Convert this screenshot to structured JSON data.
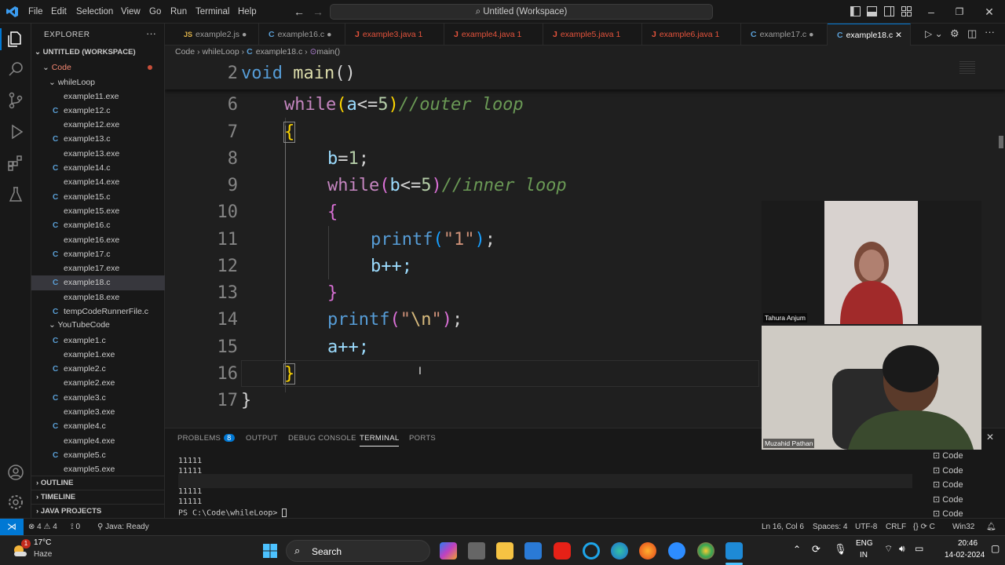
{
  "menu": [
    "File",
    "Edit",
    "Selection",
    "View",
    "Go",
    "Run",
    "Terminal",
    "Help"
  ],
  "command_center": "Untitled (Workspace)",
  "sidebar": {
    "title": "EXPLORER",
    "workspace": "UNTITLED (WORKSPACE)",
    "root": "Code",
    "folder1": "whileLoop",
    "files1": [
      "example11.exe",
      "example12.c",
      "example12.exe",
      "example13.c",
      "example13.exe",
      "example14.c",
      "example14.exe",
      "example15.c",
      "example15.exe",
      "example16.c",
      "example16.exe",
      "example17.c",
      "example17.exe",
      "example18.c",
      "example18.exe",
      "tempCodeRunnerFile.c"
    ],
    "folder2": "YouTubeCode",
    "files2": [
      "example1.c",
      "example1.exe",
      "example2.c",
      "example2.exe",
      "example3.c",
      "example3.exe",
      "example4.c",
      "example4.exe",
      "example5.c",
      "example5.exe"
    ],
    "sections": [
      "OUTLINE",
      "TIMELINE",
      "JAVA PROJECTS"
    ]
  },
  "tabs": [
    {
      "kind": "JS",
      "name": "example2.js",
      "suffix": "●"
    },
    {
      "kind": "C",
      "name": "example16.c",
      "suffix": "●"
    },
    {
      "kind": "J",
      "name": "example3.java",
      "suffix": "1"
    },
    {
      "kind": "J",
      "name": "example4.java",
      "suffix": "1"
    },
    {
      "kind": "J",
      "name": "example5.java",
      "suffix": "1"
    },
    {
      "kind": "J",
      "name": "example6.java",
      "suffix": "1"
    },
    {
      "kind": "C",
      "name": "example17.c",
      "suffix": "●"
    },
    {
      "kind": "C",
      "name": "example18.c",
      "suffix": "✕"
    }
  ],
  "breadcrumb": [
    "Code",
    "whileLoop",
    "example18.c",
    "main()"
  ],
  "code": {
    "sticky_line": "2",
    "sticky_void": "void",
    "sticky_main": "main",
    "lines": [
      "6",
      "7",
      "8",
      "9",
      "10",
      "11",
      "12",
      "13",
      "14",
      "15",
      "16",
      "17"
    ],
    "while1": "while",
    "cond1_var": "a",
    "cond1_op": "<=",
    "cond1_num": "5",
    "comment1": "//outer loop",
    "b_assign": "b",
    "b_val": "1",
    "while2": "while",
    "cond2_var": "b",
    "cond2_num": "5",
    "comment2": "//inner loop",
    "printf1": "printf",
    "str1": "\"1\"",
    "b_inc": "b++;",
    "printf2": "printf",
    "str2_a": "\"",
    "str2_esc": "\\n",
    "str2_b": "\"",
    "a_inc": "a++;"
  },
  "panel": {
    "tabs": [
      "PROBLEMS",
      "OUTPUT",
      "DEBUG CONSOLE",
      "TERMINAL",
      "PORTS"
    ],
    "problems_count": "8",
    "output": [
      "11111",
      "11111",
      "11111",
      "11111",
      "11111"
    ],
    "prompt": "PS C:\\Code\\whileLoop> ",
    "terminals": [
      "Code",
      "Code",
      "Code",
      "Code",
      "Code"
    ]
  },
  "status": {
    "errors": "4",
    "warnings": "4",
    "ports": "0",
    "java": "Java: Ready",
    "position": "Ln 16, Col 6",
    "spaces": "Spaces: 4",
    "encoding": "UTF-8",
    "eol": "CRLF",
    "lang": "C",
    "platform": "Win32"
  },
  "video": {
    "participant1": "Tahura Anjum",
    "participant2": "Muzahid Pathan"
  },
  "taskbar": {
    "temp": "17°C",
    "weather": "Haze",
    "search": "Search",
    "lang1": "ENG",
    "lang2": "IN",
    "time": "20:46",
    "date": "14-02-2024",
    "notif": "1"
  },
  "colors": {
    "accent": "#0078d4",
    "bg": "#1f1f1f",
    "sidebar": "#181818"
  }
}
